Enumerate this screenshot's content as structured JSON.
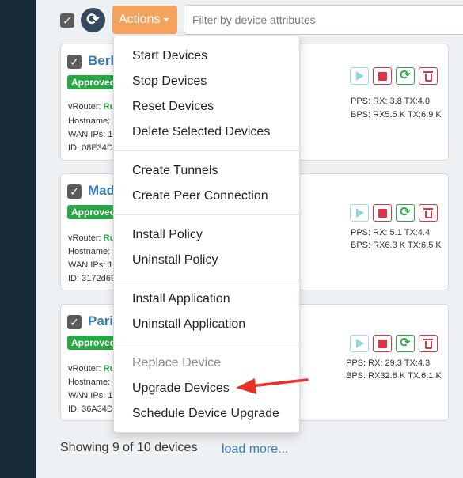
{
  "toolbar": {
    "actions_label": "Actions",
    "filter_placeholder": "Filter by device attributes"
  },
  "devices": [
    {
      "name": "Berli",
      "status": "Approved",
      "vrouter_label": "vRouter:",
      "vrouter_value": "Ru",
      "hostname": "Hostname:",
      "wan": "WAN IPs: 10",
      "id": "ID: 08E34D5",
      "pps": "PPS: RX: 3.8 TX:4.0",
      "bps": "BPS: RX5.5 K TX:6.9 K"
    },
    {
      "name": "Mad",
      "status": "Approved",
      "vrouter_label": "vRouter:",
      "vrouter_value": "Ru",
      "hostname": "Hostname:",
      "wan": "WAN IPs: 19",
      "id": "ID: 3172d69",
      "pps": "PPS: RX: 5.1 TX:4.4",
      "bps": "BPS: RX6.3 K TX:6.5 K"
    },
    {
      "name": "Paris",
      "status": "Approved",
      "vrouter_label": "vRouter:",
      "vrouter_value": "Ru",
      "hostname": "Hostname:",
      "wan": "WAN IPs: 1",
      "id": "ID: 36A34D",
      "pps": "PPS: RX: 29.3 TX:4.3",
      "bps": "BPS: RX32.8 K TX:6.1 K"
    }
  ],
  "menu": {
    "groups": [
      [
        "Start Devices",
        "Stop Devices",
        "Reset Devices",
        "Delete Selected Devices"
      ],
      [
        "Create Tunnels",
        "Create Peer Connection"
      ],
      [
        "Install Policy",
        "Uninstall Policy"
      ],
      [
        "Install Application",
        "Uninstall Application"
      ],
      [
        "Replace Device",
        "Upgrade Devices",
        "Schedule Device Upgrade"
      ]
    ],
    "disabled_items": [
      "Replace Device"
    ]
  },
  "footer": {
    "showing": "Showing 9 of 10 devices",
    "load_more": "load more..."
  },
  "colors": {
    "sidebar": "#172a3a",
    "actions_button": "#f5a25d",
    "approved_badge": "#28a745",
    "device_link": "#3a7cb5",
    "annotation_arrow": "#e8302a"
  },
  "icons": {
    "refresh": "refresh-icon",
    "play": "play-icon",
    "stop": "stop-icon",
    "reset": "sync-icon",
    "delete": "trash-icon"
  }
}
